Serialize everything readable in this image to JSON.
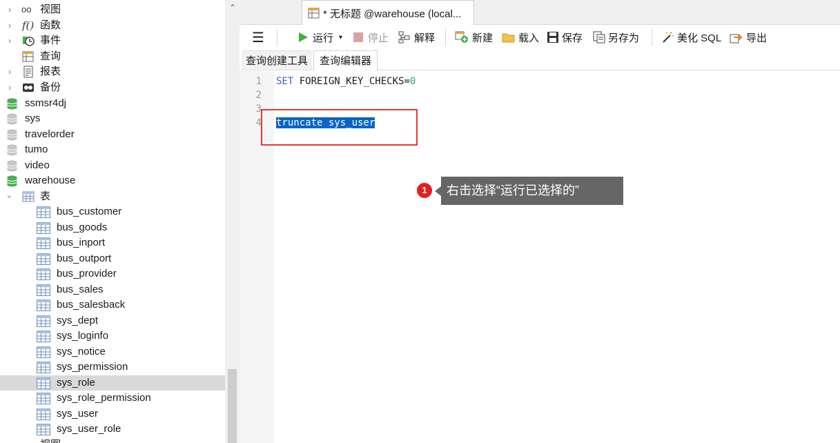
{
  "sidebar": {
    "top_items": [
      {
        "label": "视图",
        "icon": "glasses-icon",
        "expandable": true
      },
      {
        "label": "函数",
        "icon": "function-icon",
        "expandable": true
      },
      {
        "label": "事件",
        "icon": "clock-icon",
        "expandable": true
      },
      {
        "label": "查询",
        "icon": "query-icon",
        "expandable": false
      },
      {
        "label": "报表",
        "icon": "report-icon",
        "expandable": true
      },
      {
        "label": "备份",
        "icon": "backup-icon",
        "expandable": true
      }
    ],
    "databases": [
      {
        "label": "ssmsr4dj",
        "open": true
      },
      {
        "label": "sys",
        "open": false
      },
      {
        "label": "travelorder",
        "open": false
      },
      {
        "label": "tumo",
        "open": false
      },
      {
        "label": "video",
        "open": false
      },
      {
        "label": "warehouse",
        "open": true
      }
    ],
    "tables_group_label": "表",
    "tables": [
      "bus_customer",
      "bus_goods",
      "bus_inport",
      "bus_outport",
      "bus_provider",
      "bus_sales",
      "bus_salesback",
      "sys_dept",
      "sys_loginfo",
      "sys_notice",
      "sys_permission",
      "sys_role",
      "sys_role_permission",
      "sys_user",
      "sys_user_role"
    ],
    "selected_table": "sys_role",
    "bottom_partial_label": "视图"
  },
  "tab": {
    "title": "* 无标题 @warehouse (local..."
  },
  "toolbar": {
    "menu_icon": "hamburger-icon",
    "run": "运行",
    "stop": "停止",
    "explain": "解释",
    "new": "新建",
    "load": "载入",
    "save": "保存",
    "save_as": "另存为",
    "beautify": "美化 SQL",
    "export": "导出"
  },
  "subtabs": {
    "builder": "查询创建工具",
    "editor": "查询编辑器"
  },
  "editor": {
    "line_numbers": [
      "1",
      "2",
      "3",
      "4"
    ],
    "line1_keyword": "SET",
    "line1_rest": " FOREIGN_KEY_CHECKS=",
    "line1_value": "0",
    "line4_selected": "truncate sys_user"
  },
  "annotation": {
    "badge": "1",
    "text": "右击选择“运行已选择的”",
    "box_color": "#e53935"
  },
  "colors": {
    "selection": "#0a64c8",
    "keyword": "#3a62d6",
    "db_open": "#4caf50",
    "db_closed": "#bdbdbd",
    "callout_bg": "#666666"
  }
}
